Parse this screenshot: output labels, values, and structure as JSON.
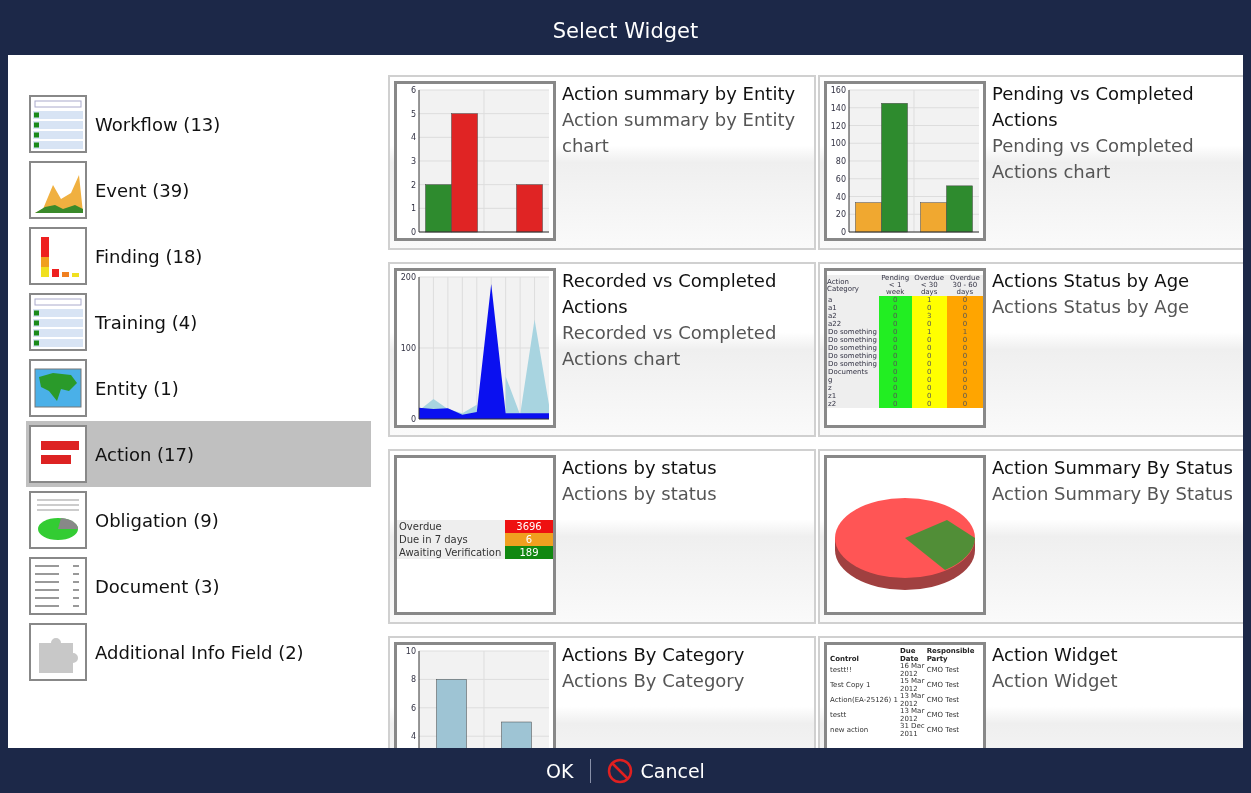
{
  "window": {
    "title": "Select Widget"
  },
  "sidebar": {
    "items": [
      {
        "label": "Workflow (13)",
        "kind": "list",
        "selected": false
      },
      {
        "label": "Event (39)",
        "kind": "area",
        "selected": false
      },
      {
        "label": "Finding (18)",
        "kind": "bars",
        "selected": false
      },
      {
        "label": "Training (4)",
        "kind": "list",
        "selected": false
      },
      {
        "label": "Entity (1)",
        "kind": "map",
        "selected": false
      },
      {
        "label": "Action (17)",
        "kind": "hbars",
        "selected": true
      },
      {
        "label": "Obligation (9)",
        "kind": "pie",
        "selected": false
      },
      {
        "label": "Document (3)",
        "kind": "table",
        "selected": false
      },
      {
        "label": "Additional Info Field (2)",
        "kind": "puzzle",
        "selected": false
      }
    ]
  },
  "widgets": [
    {
      "title": "Action summary by Entity",
      "description": "Action summary by Entity chart",
      "preview": {
        "kind": "bar_chart",
        "chart_data": {
          "type": "bar",
          "grid": true,
          "ylim": [
            0,
            6
          ],
          "yticks": [
            0,
            1,
            2,
            3,
            4,
            5,
            6
          ],
          "series": [
            {
              "color": "#2e8b2e",
              "values": [
                2,
                null
              ]
            },
            {
              "color": "#e02424",
              "values": [
                5,
                2
              ]
            }
          ]
        }
      }
    },
    {
      "title": "Pending vs Completed Actions",
      "description": "Pending vs Completed Actions chart",
      "preview": {
        "kind": "bar_chart",
        "chart_data": {
          "type": "bar",
          "grid": true,
          "ylim": [
            0,
            160
          ],
          "yticks": [
            0,
            20,
            40,
            60,
            80,
            100,
            120,
            140,
            160
          ],
          "series": [
            {
              "color": "#f0a830",
              "values": [
                33,
                33
              ]
            },
            {
              "color": "#2e8b2e",
              "values": [
                145,
                52
              ]
            }
          ]
        }
      }
    },
    {
      "title": "Recorded vs Completed Actions",
      "description": "Recorded vs Completed Actions chart",
      "preview": {
        "kind": "area_chart",
        "chart_data": {
          "type": "area",
          "grid": true,
          "ylim": [
            0,
            200
          ],
          "yticks": [
            0,
            100,
            200
          ],
          "series": [
            {
              "color": "#a8d4e0",
              "values": [
                12,
                28,
                14,
                8,
                20,
                null,
                60,
                6,
                140,
                20
              ]
            },
            {
              "color": "#0a10f0",
              "values": [
                16,
                14,
                15,
                6,
                10,
                190,
                8,
                8,
                8,
                8
              ]
            }
          ]
        }
      }
    },
    {
      "title": "Actions Status by Age",
      "description": "Actions Status by Age",
      "preview": {
        "kind": "age_table",
        "columns": [
          {
            "label": "Action Category"
          },
          {
            "label": "Pending < 1 week",
            "color": "#22ee22"
          },
          {
            "label": "Overdue < 30 days",
            "color": "#ffff00"
          },
          {
            "label": "Overdue 30 - 60 days",
            "color": "#ffa500"
          }
        ],
        "rows": [
          [
            "a",
            "0",
            "1",
            "0"
          ],
          [
            "a1",
            "0",
            "0",
            "0"
          ],
          [
            "a2",
            "0",
            "3",
            "0"
          ],
          [
            "a22",
            "0",
            "0",
            "0"
          ],
          [
            "Do something",
            "0",
            "1",
            "1"
          ],
          [
            "Do something",
            "0",
            "0",
            "0"
          ],
          [
            "Do something",
            "0",
            "0",
            "0"
          ],
          [
            "Do something",
            "0",
            "0",
            "0"
          ],
          [
            "Do something",
            "0",
            "0",
            "0"
          ],
          [
            "Documents",
            "0",
            "0",
            "0"
          ],
          [
            "g",
            "0",
            "0",
            "0"
          ],
          [
            "z",
            "0",
            "0",
            "0"
          ],
          [
            "z1",
            "0",
            "0",
            "0"
          ],
          [
            "z2",
            "0",
            "0",
            "0"
          ]
        ]
      }
    },
    {
      "title": "Actions by status",
      "description": "Actions by status",
      "preview": {
        "kind": "status_table",
        "rows": [
          {
            "label": "Overdue",
            "value": "3696",
            "color": "#ee1111"
          },
          {
            "label": "Due in 7 days",
            "value": "6",
            "color": "#f0a020"
          },
          {
            "label": "Awaiting Verification",
            "value": "189",
            "color": "#118811"
          }
        ]
      }
    },
    {
      "title": "Action Summary By Status",
      "description": "Action Summary By Status",
      "preview": {
        "kind": "pie"
      }
    },
    {
      "title": "Actions By Category",
      "description": "Actions By Category",
      "preview": {
        "kind": "bar_chart",
        "chart_data": {
          "type": "bar",
          "grid": true,
          "ylim": [
            0,
            10
          ],
          "yticks": [
            4,
            6,
            8,
            10
          ],
          "series": [
            {
              "color": "#9ec4d4",
              "values": [
                8,
                5
              ]
            }
          ]
        }
      }
    },
    {
      "title": "Action Widget",
      "description": "Action Widget",
      "preview": {
        "kind": "action_table",
        "columns": [
          "Control",
          "Due Date",
          "Responsible Party"
        ],
        "rows": [
          [
            "testt!!",
            "16 Mar 2012",
            "CMO Test"
          ],
          [
            "Test Copy 1",
            "15 Mar 2012",
            "CMO Test"
          ],
          [
            "Action(EA-25126) 1",
            "13 Mar 2012",
            "CMO Test"
          ],
          [
            "testt",
            "13 Mar 2012",
            "CMO Test"
          ],
          [
            "new action",
            "31 Dec 2011",
            "CMO Test"
          ]
        ]
      }
    }
  ],
  "footer": {
    "ok": "OK",
    "cancel": "Cancel"
  }
}
